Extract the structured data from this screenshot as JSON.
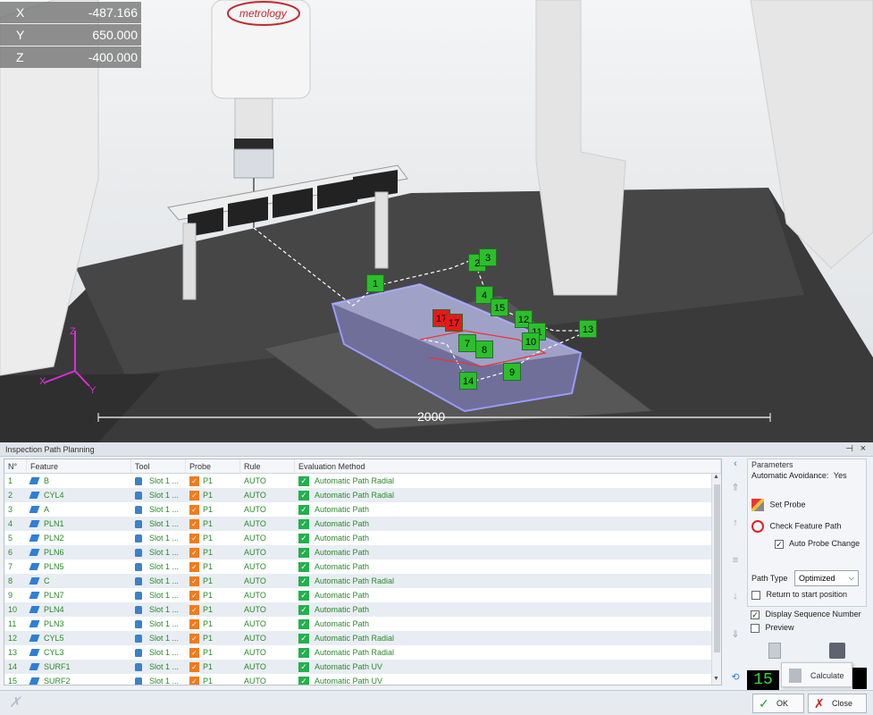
{
  "viewport": {
    "coords": [
      {
        "axis": "X",
        "value": "-487.166"
      },
      {
        "axis": "Y",
        "value": "650.000"
      },
      {
        "axis": "Z",
        "value": "-400.000"
      }
    ],
    "scale_label": "2000",
    "axis_labels": {
      "x": "X",
      "y": "Y",
      "z": "Z"
    },
    "brand_text": "metrology",
    "markers": [
      "1",
      "2",
      "3",
      "4",
      "15",
      "12",
      "11",
      "13",
      "10",
      "7",
      "8",
      "9",
      "14",
      "17",
      "17"
    ]
  },
  "panel": {
    "title": "Inspection Path Planning",
    "pin_icon": "pin-icon",
    "columns": [
      "N°",
      "Feature",
      "Tool",
      "Probe",
      "Rule",
      "Evaluation Method"
    ],
    "rows": [
      {
        "n": "1",
        "feature": "B",
        "tool": "Slot 1 ...",
        "probe": "P1",
        "rule": "AUTO",
        "eval": "Automatic Path Radial"
      },
      {
        "n": "2",
        "feature": "CYL4",
        "tool": "Slot 1 ...",
        "probe": "P1",
        "rule": "AUTO",
        "eval": "Automatic Path Radial"
      },
      {
        "n": "3",
        "feature": "A",
        "tool": "Slot 1 ...",
        "probe": "P1",
        "rule": "AUTO",
        "eval": "Automatic Path"
      },
      {
        "n": "4",
        "feature": "PLN1",
        "tool": "Slot 1 ...",
        "probe": "P1",
        "rule": "AUTO",
        "eval": "Automatic Path"
      },
      {
        "n": "5",
        "feature": "PLN2",
        "tool": "Slot 1 ...",
        "probe": "P1",
        "rule": "AUTO",
        "eval": "Automatic Path"
      },
      {
        "n": "6",
        "feature": "PLN6",
        "tool": "Slot 1 ...",
        "probe": "P1",
        "rule": "AUTO",
        "eval": "Automatic Path"
      },
      {
        "n": "7",
        "feature": "PLN5",
        "tool": "Slot 1 ...",
        "probe": "P1",
        "rule": "AUTO",
        "eval": "Automatic Path"
      },
      {
        "n": "8",
        "feature": "C",
        "tool": "Slot 1 ...",
        "probe": "P1",
        "rule": "AUTO",
        "eval": "Automatic Path Radial"
      },
      {
        "n": "9",
        "feature": "PLN7",
        "tool": "Slot 1 ...",
        "probe": "P1",
        "rule": "AUTO",
        "eval": "Automatic Path"
      },
      {
        "n": "10",
        "feature": "PLN4",
        "tool": "Slot 1 ...",
        "probe": "P1",
        "rule": "AUTO",
        "eval": "Automatic Path"
      },
      {
        "n": "11",
        "feature": "PLN3",
        "tool": "Slot 1 ...",
        "probe": "P1",
        "rule": "AUTO",
        "eval": "Automatic Path"
      },
      {
        "n": "12",
        "feature": "CYL5",
        "tool": "Slot 1 ...",
        "probe": "P1",
        "rule": "AUTO",
        "eval": "Automatic Path Radial"
      },
      {
        "n": "13",
        "feature": "CYL3",
        "tool": "Slot 1 ...",
        "probe": "P1",
        "rule": "AUTO",
        "eval": "Automatic Path Radial"
      },
      {
        "n": "14",
        "feature": "SURF1",
        "tool": "Slot 1 ...",
        "probe": "P1",
        "rule": "AUTO",
        "eval": "Automatic Path UV"
      },
      {
        "n": "15",
        "feature": "SURF2",
        "tool": "Slot 1 ...",
        "probe": "P1",
        "rule": "AUTO",
        "eval": "Automatic Path UV"
      }
    ]
  },
  "params": {
    "title": "Parameters",
    "avoidance_label": "Automatic Avoidance:",
    "avoidance_value": "Yes",
    "set_probe": "Set Probe",
    "check_feature_path": "Check Feature Path",
    "auto_probe_change": "Auto Probe Change",
    "path_type_label": "Path Type",
    "path_type_value": "Optimized",
    "return_to_start": "Return to start position",
    "display_sequence": "Display Sequence Number",
    "preview": "Preview"
  },
  "counter": "15",
  "calculate_label": "Calculate",
  "footer": {
    "ok": "OK",
    "close": "Close"
  },
  "colors": {
    "accent_green": "#2a8a2a",
    "marker_green": "#2bbf2b",
    "marker_red": "#e51a1a",
    "probe_orange": "#f07b1e"
  }
}
